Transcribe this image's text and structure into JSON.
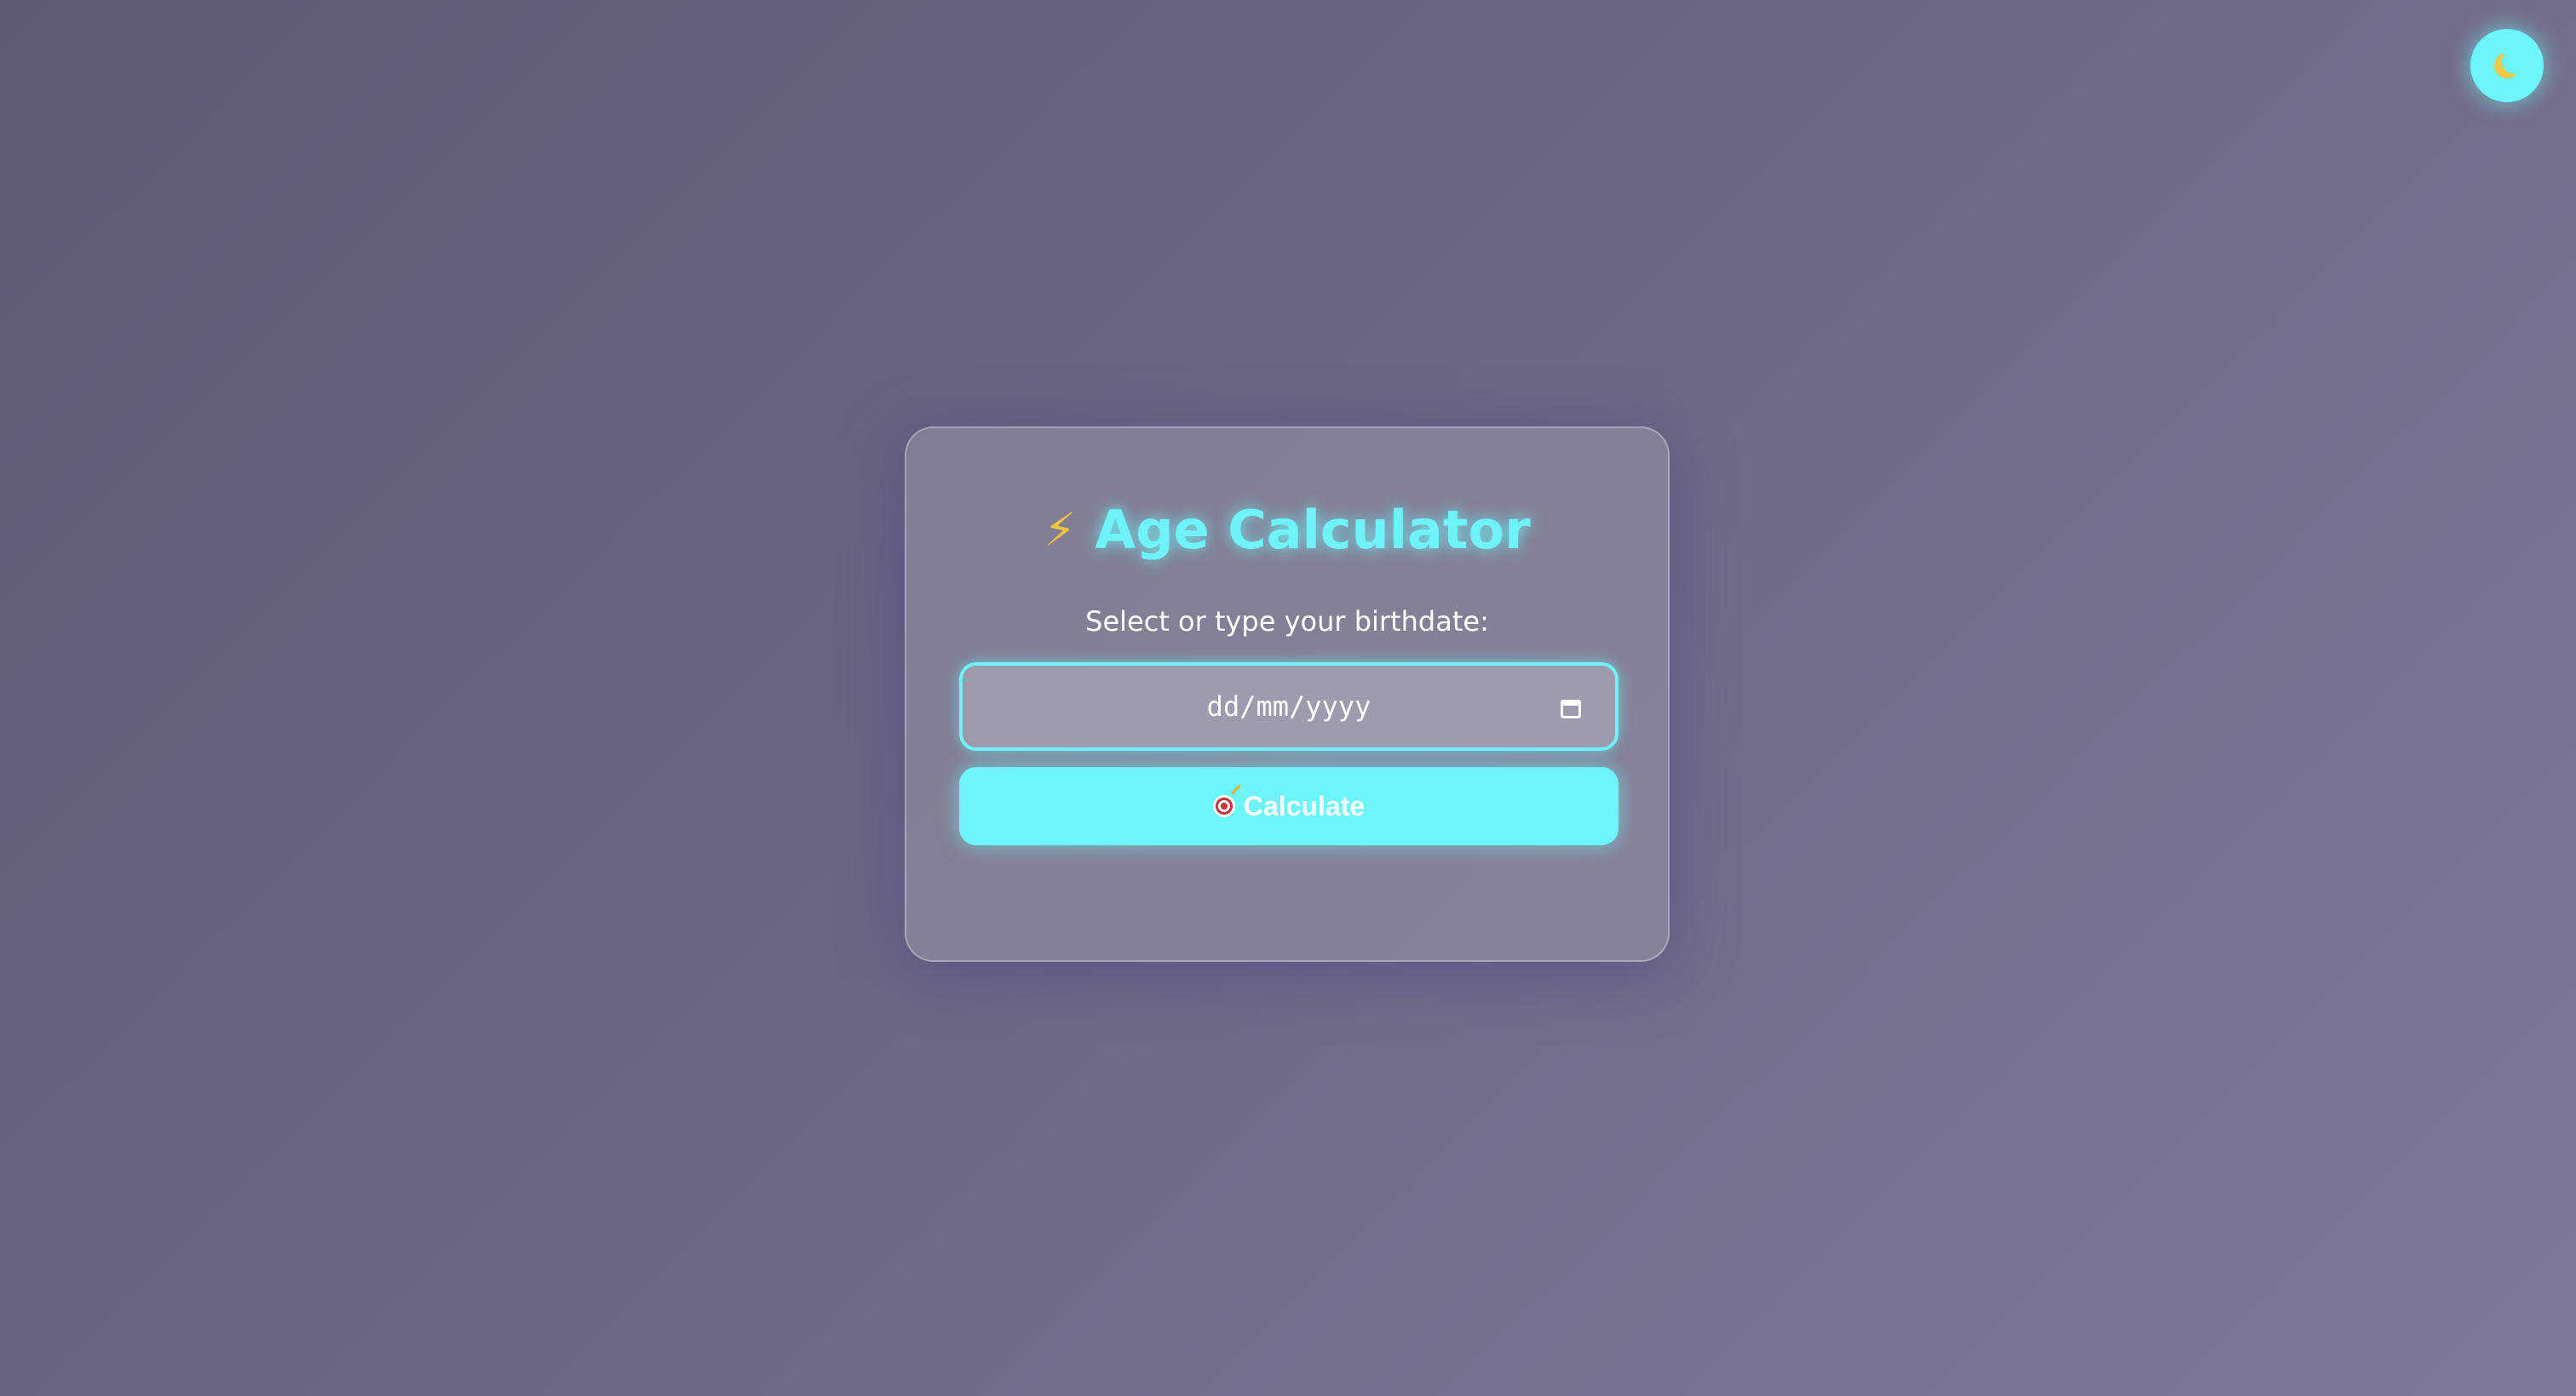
{
  "header": {
    "theme_toggle_icon": "moon-icon"
  },
  "card": {
    "title_icon": "lightning-bolt-icon",
    "title_icon_glyph": "⚡",
    "title": "Age Calculator",
    "prompt_label": "Select or type your birthdate:",
    "date_input": {
      "placeholder": "dd/mm/yyyy",
      "value": "",
      "picker_icon": "calendar-icon"
    },
    "calculate_button": {
      "icon": "target-icon",
      "label": "Calculate"
    }
  },
  "colors": {
    "accent": "#6ef4fb",
    "background": "#6d6882",
    "bolt": "#f5c43d",
    "moon": "#f2c84b"
  }
}
